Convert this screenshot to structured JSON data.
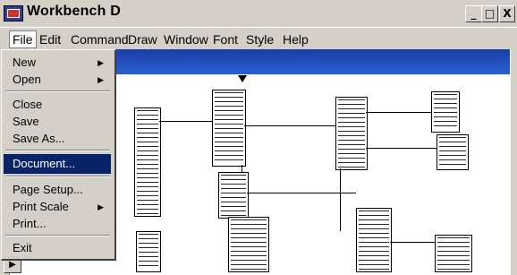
{
  "window": {
    "title": "Workbench D",
    "minimize_glyph": "_",
    "maximize_glyph": "□",
    "close_glyph": "X",
    "app_icon": "workbench-app-icon"
  },
  "menubar": {
    "items": [
      "File",
      "Edit",
      "Command",
      "Draw",
      "Window",
      "Font",
      "Style",
      "Help"
    ],
    "active": "File"
  },
  "file_menu": {
    "items": [
      {
        "label": "New",
        "submenu": true
      },
      {
        "label": "Open",
        "submenu": true
      },
      {
        "label": "Close",
        "submenu": false
      },
      {
        "label": "Save",
        "submenu": false
      },
      {
        "label": "Save As...",
        "submenu": false
      },
      {
        "label": "Document...",
        "submenu": false,
        "highlighted": true
      },
      {
        "label": "Page Setup...",
        "submenu": false
      },
      {
        "label": "Print Scale",
        "submenu": true
      },
      {
        "label": "Print...",
        "submenu": false
      },
      {
        "label": "Exit",
        "submenu": false
      }
    ],
    "submenu_arrow": "▶"
  },
  "canvas": {
    "play_glyph": "▶",
    "colors": {
      "accent": "#0a246a",
      "header_strip": "#1a3ea8"
    }
  }
}
